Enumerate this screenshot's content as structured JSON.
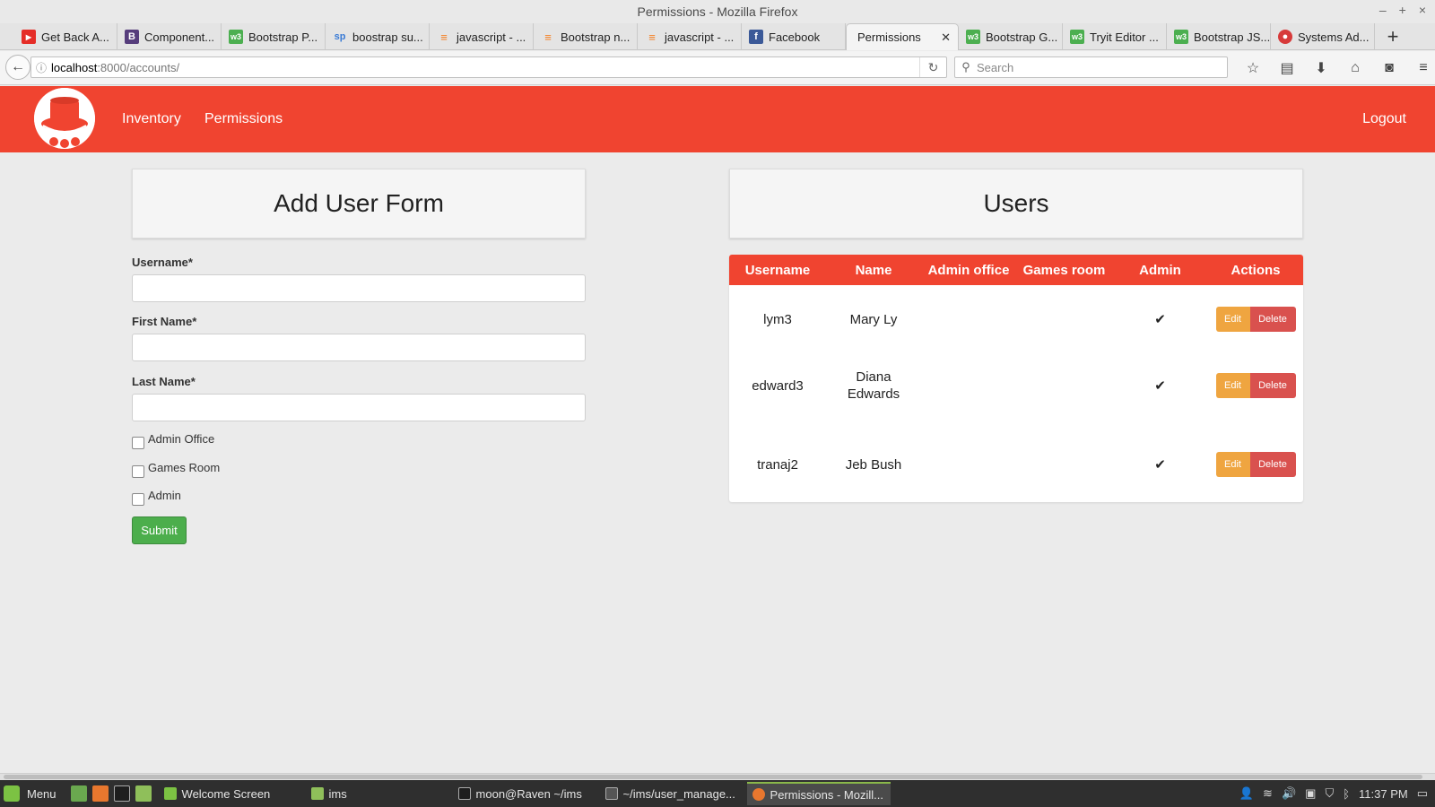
{
  "window": {
    "title": "Permissions - Mozilla Firefox"
  },
  "tabs": [
    {
      "label": "Get Back A...",
      "icon": "youtube-icon",
      "color": "#e52d27"
    },
    {
      "label": "Component...",
      "icon": "bootstrap-icon",
      "color": "#563d7c"
    },
    {
      "label": "Bootstrap P...",
      "icon": "w3schools-icon",
      "color": "#4caf50"
    },
    {
      "label": "boostrap su...",
      "icon": "sitepoint-icon",
      "color": "#3a7bd5"
    },
    {
      "label": "javascript - ...",
      "icon": "stackoverflow-icon",
      "color": "#f48024"
    },
    {
      "label": "Bootstrap n...",
      "icon": "stackoverflow-icon",
      "color": "#f48024"
    },
    {
      "label": "javascript - ...",
      "icon": "stackoverflow-icon",
      "color": "#f48024"
    },
    {
      "label": "Facebook",
      "icon": "facebook-icon",
      "color": "#3b5998"
    },
    {
      "label": "Permissions",
      "icon": "",
      "color": "",
      "active": true
    },
    {
      "label": "Bootstrap G...",
      "icon": "w3schools-icon",
      "color": "#4caf50"
    },
    {
      "label": "Tryit Editor ...",
      "icon": "w3schools-icon",
      "color": "#4caf50"
    },
    {
      "label": "Bootstrap JS...",
      "icon": "w3schools-icon",
      "color": "#4caf50"
    },
    {
      "label": "Systems Ad...",
      "icon": "globe-icon",
      "color": "#d73a3a"
    }
  ],
  "address": {
    "host": "localhost",
    "path": ":8000/accounts/"
  },
  "search": {
    "placeholder": "Search"
  },
  "app": {
    "accent": "#f04430",
    "nav": {
      "inventory": "Inventory",
      "permissions": "Permissions",
      "logout": "Logout"
    }
  },
  "form": {
    "title": "Add User Form",
    "username_label": "Username*",
    "firstname_label": "First Name*",
    "lastname_label": "Last Name*",
    "admin_office_label": "Admin Office",
    "games_room_label": "Games Room",
    "admin_label": "Admin",
    "submit_label": "Submit"
  },
  "users": {
    "title": "Users",
    "columns": [
      "Username",
      "Name",
      "Admin office",
      "Games room",
      "Admin",
      "Actions"
    ],
    "edit_label": "Edit",
    "delete_label": "Delete",
    "rows": [
      {
        "username": "lym3",
        "name": "Mary Ly",
        "admin_office": "",
        "games_room": "",
        "admin": "✔"
      },
      {
        "username": "edward3",
        "name": "Diana Edwards",
        "admin_office": "",
        "games_room": "",
        "admin": "✔"
      },
      {
        "username": "tranaj2",
        "name": "Jeb Bush",
        "admin_office": "",
        "games_room": "",
        "admin": "✔"
      }
    ]
  },
  "taskbar": {
    "menu_label": "Menu",
    "windows": [
      {
        "label": "Welcome Screen"
      },
      {
        "label": "ims"
      },
      {
        "label": "moon@Raven ~/ims"
      },
      {
        "label": "~/ims/user_manage..."
      },
      {
        "label": "Permissions - Mozill...",
        "active": true
      }
    ],
    "clock": "11:37 PM"
  }
}
